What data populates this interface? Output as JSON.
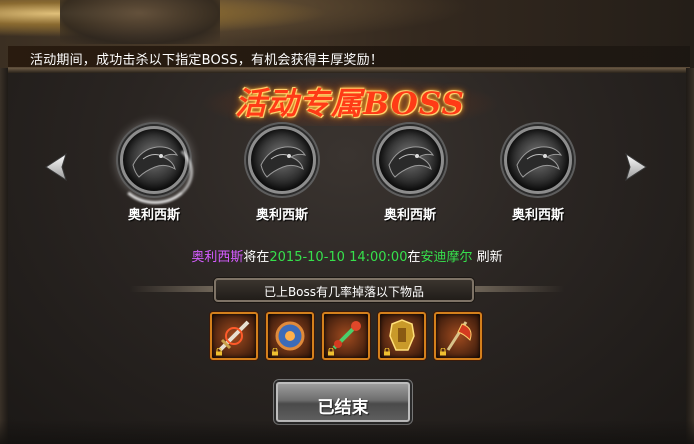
{
  "banner": {
    "text": "活动期间，成功击杀以下指定BOSS，有机会获得丰厚奖励！"
  },
  "title": "活动专属BOSS",
  "bosses": [
    {
      "name": "奥利西斯",
      "selected": true
    },
    {
      "name": "奥利西斯",
      "selected": false
    },
    {
      "name": "奥利西斯",
      "selected": false
    },
    {
      "name": "奥利西斯",
      "selected": false
    }
  ],
  "info": {
    "boss_name": "奥利西斯",
    "text_will_at": "将在",
    "time": "2015-10-10 14:00:00",
    "text_at": "在",
    "location": "安迪摩尔",
    "text_refresh": " 刷新"
  },
  "drops": {
    "label": "已上Boss有几率掉落以下物品",
    "items": [
      {
        "icon": "sword-item-icon"
      },
      {
        "icon": "shield-item-icon"
      },
      {
        "icon": "staff-item-icon"
      },
      {
        "icon": "armor-item-icon"
      },
      {
        "icon": "axe-item-icon"
      }
    ]
  },
  "button": {
    "label": "已结束"
  },
  "colors": {
    "title": "#ff3b16",
    "boss_name_highlight": "#d45cff",
    "time_highlight": "#36e04c",
    "slot_border": "#d4801c"
  }
}
